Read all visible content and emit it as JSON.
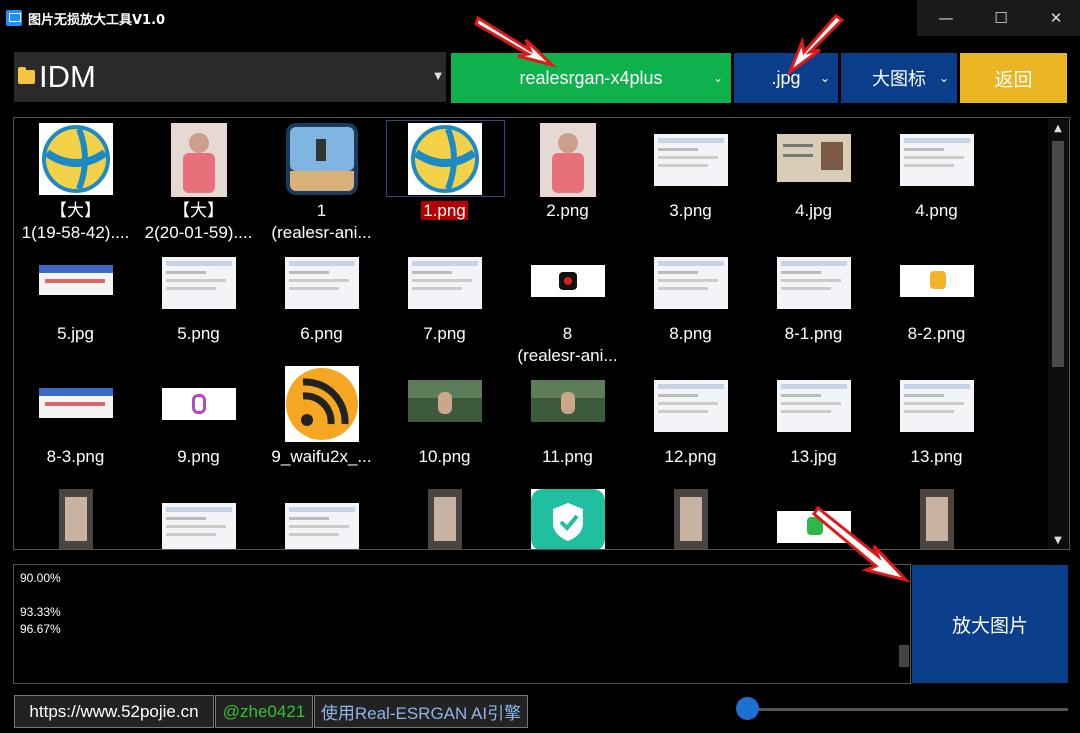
{
  "window": {
    "title": "图片无损放大工具V1.0",
    "minimize": "—",
    "maximize": "☐",
    "close": "✕"
  },
  "toolbar": {
    "folder": "IDM",
    "model": "realesrgan-x4plus",
    "format": ".jpg",
    "view": "大图标",
    "back": "返回",
    "accent_model": "#0fb14c",
    "accent_blue": "#0a3d8a",
    "accent_back": "#eab422"
  },
  "files": [
    {
      "l1": "【大】",
      "l2": "1(19-58-42)....",
      "thumb": "ball"
    },
    {
      "l1": "【大】",
      "l2": "2(20-01-59)....",
      "thumb": "girl"
    },
    {
      "l1": "1",
      "l2": "(realesr-ani...",
      "thumb": "jump"
    },
    {
      "l1": "1.png",
      "l2": "",
      "thumb": "ball",
      "selected": true
    },
    {
      "l1": "2.png",
      "l2": "",
      "thumb": "girl"
    },
    {
      "l1": "3.png",
      "l2": "",
      "thumb": "screen"
    },
    {
      "l1": "4.jpg",
      "l2": "",
      "thumb": "idcard"
    },
    {
      "l1": "4.png",
      "l2": "",
      "thumb": "screen"
    },
    {
      "l1": "5.jpg",
      "l2": "",
      "thumb": "strip"
    },
    {
      "l1": "5.png",
      "l2": "",
      "thumb": "screen"
    },
    {
      "l1": "6.png",
      "l2": "",
      "thumb": "screen"
    },
    {
      "l1": "7.png",
      "l2": "",
      "thumb": "screen"
    },
    {
      "l1": "8",
      "l2": "(realesr-ani...",
      "thumb": "record"
    },
    {
      "l1": "8.png",
      "l2": "",
      "thumb": "screen"
    },
    {
      "l1": "8-1.png",
      "l2": "",
      "thumb": "screen"
    },
    {
      "l1": "8-2.png",
      "l2": "",
      "thumb": "thumbsup"
    },
    {
      "l1": "8-3.png",
      "l2": "",
      "thumb": "strip"
    },
    {
      "l1": "9.png",
      "l2": "",
      "thumb": "logo"
    },
    {
      "l1": "9_waifu2x_...",
      "l2": "",
      "thumb": "rss"
    },
    {
      "l1": "10.png",
      "l2": "",
      "thumb": "photo"
    },
    {
      "l1": "11.png",
      "l2": "",
      "thumb": "photo"
    },
    {
      "l1": "12.png",
      "l2": "",
      "thumb": "screen"
    },
    {
      "l1": "13.jpg",
      "l2": "",
      "thumb": "screen"
    },
    {
      "l1": "13.png",
      "l2": "",
      "thumb": "screen"
    },
    {
      "l1": "",
      "l2": "",
      "thumb": "phone"
    },
    {
      "l1": "",
      "l2": "",
      "thumb": "screen"
    },
    {
      "l1": "",
      "l2": "",
      "thumb": "screen"
    },
    {
      "l1": "",
      "l2": "",
      "thumb": "phone"
    },
    {
      "l1": "",
      "l2": "",
      "thumb": "shield"
    },
    {
      "l1": "",
      "l2": "",
      "thumb": "phone"
    },
    {
      "l1": "",
      "l2": "",
      "thumb": "kbadge"
    },
    {
      "l1": "",
      "l2": "",
      "thumb": "phone"
    }
  ],
  "log": {
    "lines": [
      "90.00%",
      "",
      "93.33%",
      "96.67%"
    ]
  },
  "enlarge_button": "放大图片",
  "status": {
    "site": "https://www.52pojie.cn",
    "author": "@zhe0421",
    "engine": "使用Real-ESRGAN AI引擎"
  },
  "slider": {
    "value": 0
  }
}
